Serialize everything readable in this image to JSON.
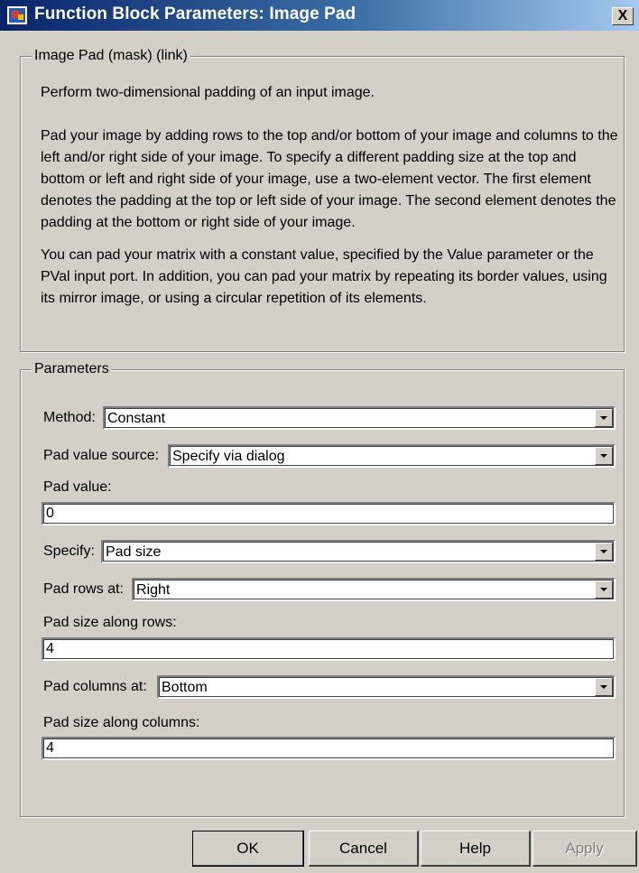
{
  "window": {
    "title": "Function Block Parameters: Image Pad",
    "close_glyph": "X",
    "icon": "simulink-block-icon"
  },
  "description": {
    "group_title": "Image Pad (mask) (link)",
    "paragraphs": [
      "Perform two-dimensional padding of an input image.",
      "Pad your image by adding rows to the top and/or bottom of your image and columns to the left and/or right side of your image. To specify a different padding size at the top and bottom or left and right side of your image, use a two-element vector. The first element denotes the padding at the top or left side of your image. The second element denotes the padding at the bottom or right side of your image.",
      "You can pad your matrix with a constant value, specified by the Value parameter or the PVal input port. In addition, you can pad your matrix by repeating its border values, using its mirror image, or using a circular repetition of its elements."
    ]
  },
  "parameters": {
    "group_title": "Parameters",
    "method": {
      "label": "Method:",
      "value": "Constant"
    },
    "pad_value_source": {
      "label": "Pad value source:",
      "value": "Specify via dialog"
    },
    "pad_value": {
      "label": "Pad value:",
      "value": "0"
    },
    "specify": {
      "label": "Specify:",
      "value": "Pad size"
    },
    "pad_rows_at": {
      "label": "Pad rows at:",
      "value": "Right"
    },
    "pad_size_rows": {
      "label": "Pad size along rows:",
      "value": "4"
    },
    "pad_columns_at": {
      "label": "Pad columns at:",
      "value": "Bottom"
    },
    "pad_size_columns": {
      "label": "Pad size along columns:",
      "value": "4"
    }
  },
  "buttons": {
    "ok": "OK",
    "cancel": "Cancel",
    "help": "Help",
    "apply": "Apply"
  },
  "colors": {
    "dialog_background": "#d4d0c8",
    "title_bar_start": "#0a246a",
    "title_bar_end": "#a6caf0",
    "disabled_text": "#808080"
  }
}
